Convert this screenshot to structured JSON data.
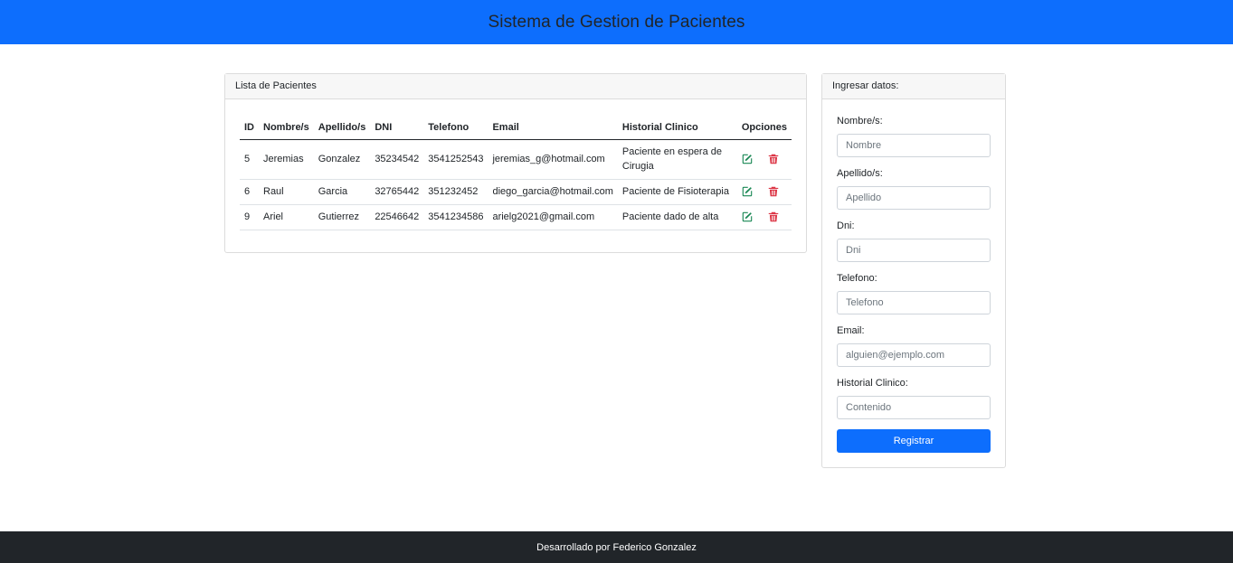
{
  "header": {
    "title": "Sistema de Gestion de Pacientes"
  },
  "list_card": {
    "title": "Lista de Pacientes",
    "columns": [
      "ID",
      "Nombre/s",
      "Apellido/s",
      "DNI",
      "Telefono",
      "Email",
      "Historial Clinico",
      "Opciones"
    ],
    "rows": [
      {
        "id": "5",
        "nombre": "Jeremias",
        "apellido": "Gonzalez",
        "dni": "35234542",
        "telefono": "3541252543",
        "email": "jeremias_g@hotmail.com",
        "historial": "Paciente en espera de Cirugia"
      },
      {
        "id": "6",
        "nombre": "Raul",
        "apellido": "Garcia",
        "dni": "32765442",
        "telefono": "351232452",
        "email": "diego_garcia@hotmail.com",
        "historial": "Paciente de Fisioterapia"
      },
      {
        "id": "9",
        "nombre": "Ariel",
        "apellido": "Gutierrez",
        "dni": "22546642",
        "telefono": "3541234586",
        "email": "arielg2021@gmail.com",
        "historial": "Paciente dado de alta"
      }
    ],
    "icons": {
      "edit": "edit-icon",
      "delete": "trash-icon"
    },
    "colors": {
      "edit": "#198754",
      "delete": "#dc3545"
    }
  },
  "form_card": {
    "title": "Ingresar datos:",
    "fields": [
      {
        "label": "Nombre/s:",
        "placeholder": "Nombre"
      },
      {
        "label": "Apellido/s:",
        "placeholder": "Apellido"
      },
      {
        "label": "Dni:",
        "placeholder": "Dni"
      },
      {
        "label": "Telefono:",
        "placeholder": "Telefono"
      },
      {
        "label": "Email:",
        "placeholder": "alguien@ejemplo.com"
      },
      {
        "label": "Historial Clinico:",
        "placeholder": "Contenido"
      }
    ],
    "submit_label": "Registrar"
  },
  "footer": {
    "text": "Desarrollado por Federico Gonzalez"
  },
  "colors": {
    "primary": "#0d6efd",
    "footer_bg": "#212529"
  }
}
